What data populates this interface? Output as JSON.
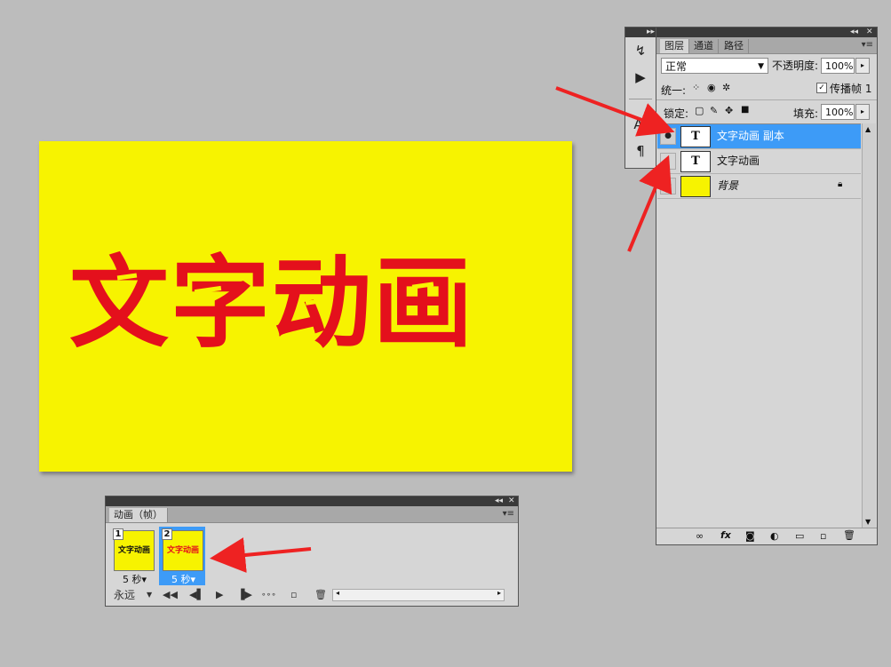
{
  "canvas": {
    "text": "文字动画",
    "background_color": "#f7f300",
    "text_color": "#e4101c"
  },
  "layers_panel": {
    "tabs": [
      "图层",
      "通道",
      "路径"
    ],
    "blend_mode": "正常",
    "opacity_label": "不透明度:",
    "opacity_value": "100%",
    "unify_label": "统一:",
    "propagate_label": "传播帧 1",
    "lock_label": "锁定:",
    "fill_label": "填充:",
    "fill_value": "100%",
    "layers": [
      {
        "name": "文字动画 副本",
        "thumb": "T",
        "visible": true,
        "selected": true
      },
      {
        "name": "文字动画",
        "thumb": "T",
        "visible": false,
        "selected": false
      },
      {
        "name": "背景",
        "thumb": "",
        "visible": true,
        "selected": false,
        "locked": true
      }
    ],
    "selected_color": "#3d9bf7"
  },
  "animation_panel": {
    "tab": "动画（帧）",
    "frames": [
      {
        "number": "1",
        "label": "文字动画",
        "delay": "5 秒▾",
        "selected": false
      },
      {
        "number": "2",
        "label": "文字动画",
        "delay": "5 秒▾",
        "selected": true
      }
    ],
    "loop": "永远"
  },
  "arrow_color": "#ee2222"
}
